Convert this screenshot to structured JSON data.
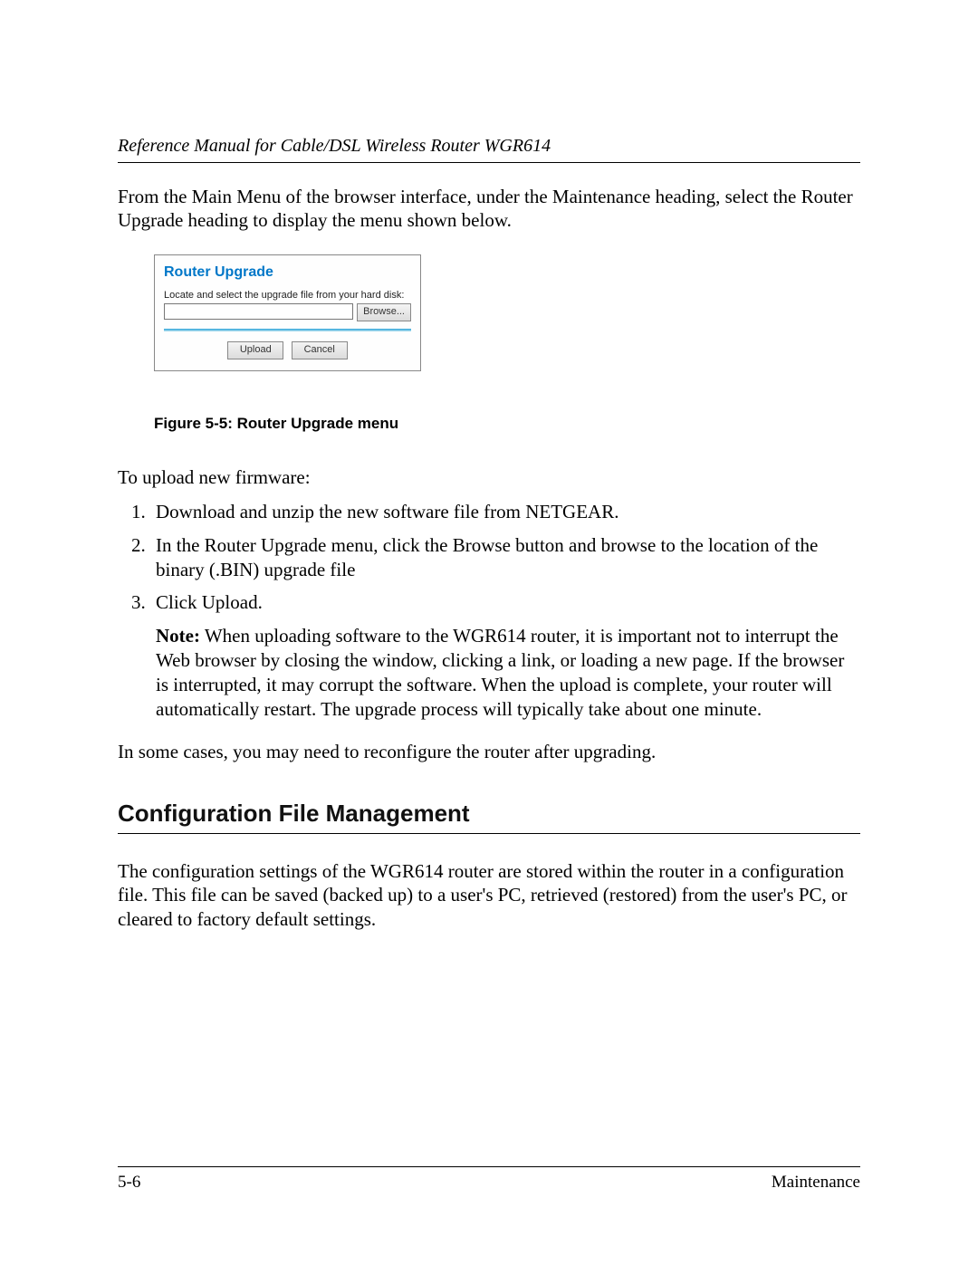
{
  "header": {
    "title": "Reference Manual for Cable/DSL Wireless Router WGR614"
  },
  "intro_para": "From the Main Menu of the browser interface, under the Maintenance heading, select the Router Upgrade heading to display the menu shown below.",
  "screenshot": {
    "title": "Router Upgrade",
    "label": "Locate and select the upgrade file from your hard disk:",
    "browse_btn": "Browse...",
    "upload_btn": "Upload",
    "cancel_btn": "Cancel"
  },
  "figure_caption": "Figure 5-5:  Router Upgrade menu",
  "upload_heading": "To upload new firmware:",
  "steps": {
    "s1": "Download and unzip the new software file from NETGEAR.",
    "s2": "In the Router Upgrade menu, click the Browse button and browse to the location of the binary (.BIN) upgrade file",
    "s3": "Click Upload.",
    "note_label": "Note:",
    "note_text": " When uploading software to the WGR614 router, it is important not to interrupt the Web browser by closing the window, clicking a link, or loading a new page. If the browser is interrupted, it may corrupt the software. When the upload is complete, your router will automatically restart. The upgrade process will typically take about one minute."
  },
  "after_steps": "In some cases, you may need to reconfigure the router after upgrading.",
  "section_title": "Configuration File Management",
  "section_para": "The configuration settings of the WGR614 router are stored within the router in a configuration file. This file can be saved (backed up) to a user's PC, retrieved (restored) from the user's PC, or cleared to factory default settings.",
  "footer": {
    "page_num": "5-6",
    "section_name": "Maintenance"
  }
}
